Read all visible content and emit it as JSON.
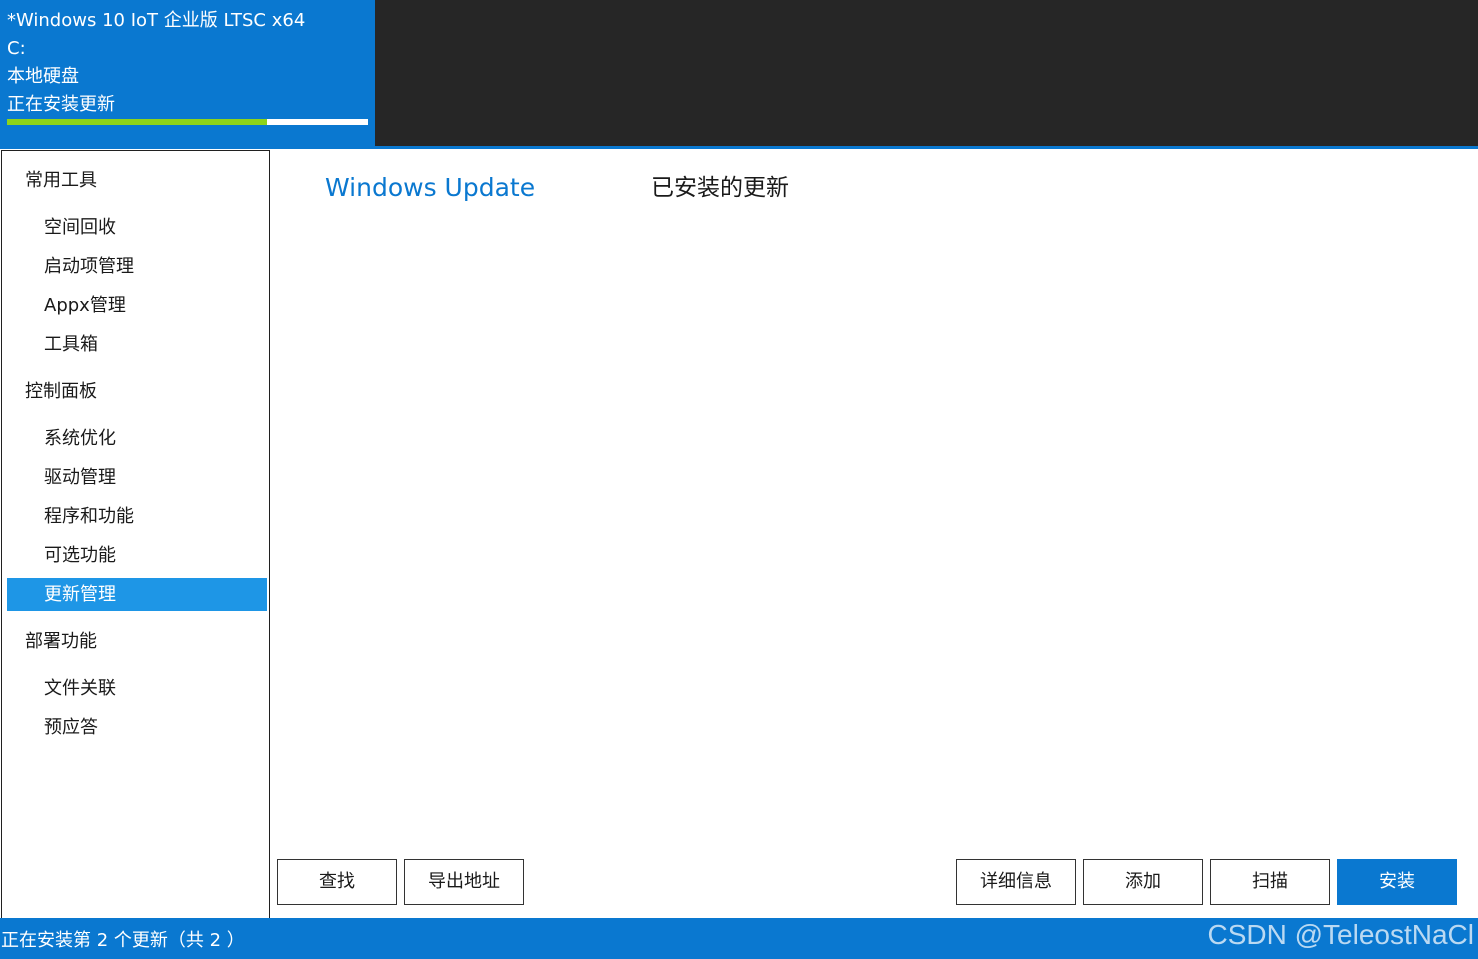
{
  "system_info": {
    "os_name": "*Windows 10 IoT 企业版 LTSC x64",
    "drive": "C:",
    "drive_type": "本地硬盘",
    "status": "正在安装更新",
    "progress": 0.72
  },
  "sidebar": {
    "groups": [
      {
        "label": "常用工具",
        "items": [
          {
            "label": "空间回收"
          },
          {
            "label": "启动项管理"
          },
          {
            "label": "Appx管理"
          },
          {
            "label": "工具箱"
          }
        ]
      },
      {
        "label": "控制面板",
        "items": [
          {
            "label": "系统优化"
          },
          {
            "label": "驱动管理"
          },
          {
            "label": "程序和功能"
          },
          {
            "label": "可选功能"
          },
          {
            "label": "更新管理",
            "selected": true
          }
        ]
      },
      {
        "label": "部署功能",
        "items": [
          {
            "label": "文件关联"
          },
          {
            "label": "预应答"
          }
        ]
      }
    ]
  },
  "main": {
    "tab_windows_update": "Windows Update",
    "tab_installed_updates": "已安装的更新"
  },
  "buttons": {
    "search": "查找",
    "export_address": "导出地址",
    "details": "详细信息",
    "add": "添加",
    "scan": "扫描",
    "install": "安装"
  },
  "status_bar": {
    "text": "正在安装第 2 个更新（共 2 ）",
    "watermark": "CSDN @TeleostNaCl"
  },
  "colors": {
    "accent": "#0a78d0",
    "selected_item": "#1e96e6",
    "progress_fill": "#8dd31a",
    "header_dark": "#262626"
  }
}
